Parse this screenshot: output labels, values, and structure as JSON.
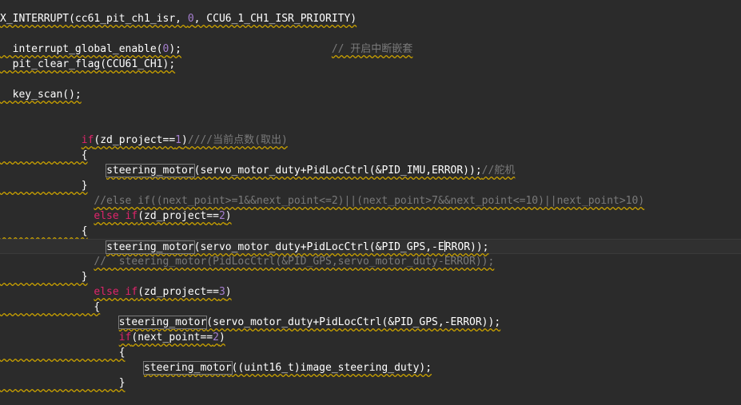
{
  "editor": {
    "lines": [
      [
        [
          "tx",
          "X_INTERRUPT(cc61_pit_ch1_isr, "
        ],
        [
          "num",
          "0"
        ],
        [
          "tx",
          ", CCU6_1_CH1_ISR_PRIORITY)"
        ]
      ],
      [],
      [
        [
          "tx",
          "  interrupt_global_enable("
        ],
        [
          "num",
          "0"
        ],
        [
          "tx",
          ");"
        ],
        [
          "tx",
          "                        "
        ],
        [
          "cm",
          "// 开启中断嵌套"
        ]
      ],
      [
        [
          "tx",
          "  pit_clear_flag(CCU61_CH1);"
        ]
      ],
      [],
      [
        [
          "tx",
          "  key_scan();"
        ]
      ],
      [],
      [],
      [
        [
          "tx",
          "             "
        ],
        [
          "kw",
          "if"
        ],
        [
          "tx",
          "(zd_project=="
        ],
        [
          "num",
          "1"
        ],
        [
          "tx",
          ")"
        ],
        [
          "cm",
          "////当前点数(取出)"
        ]
      ],
      [
        [
          "tx",
          "             {"
        ]
      ],
      [
        [
          "tx",
          "                 "
        ],
        [
          "box",
          "steering_motor"
        ],
        [
          "tx",
          "(servo_motor_duty+PidLocCtrl(&PID_IMU,ERROR));"
        ],
        [
          "cm",
          "//舵机"
        ]
      ],
      [
        [
          "tx",
          "             }"
        ]
      ],
      [
        [
          "tx",
          "               "
        ],
        [
          "cm",
          "//else if((next_point>=1&&next_point<=2)||(next_point>7&&next_point<=10)||next_point>10)"
        ]
      ],
      [
        [
          "tx",
          "               "
        ],
        [
          "kw",
          "else if"
        ],
        [
          "tx",
          "(zd_project=="
        ],
        [
          "num",
          "2"
        ],
        [
          "tx",
          ")"
        ]
      ],
      [
        [
          "tx",
          "             {"
        ]
      ],
      [
        [
          "tx",
          "                 "
        ],
        [
          "box",
          "steering_motor"
        ],
        [
          "tx",
          "(servo_motor_duty+PidLocCtrl(&PID_GPS,-E"
        ],
        [
          "cursor",
          ""
        ],
        [
          "tx",
          "RROR));"
        ]
      ],
      [
        [
          "tx",
          "               "
        ],
        [
          "cm",
          "//  steering_motor(PidLocCtrl(&PID_GPS,servo_motor_duty-ERROR));"
        ]
      ],
      [
        [
          "tx",
          "             }"
        ]
      ],
      [
        [
          "tx",
          "               "
        ],
        [
          "kw",
          "else if"
        ],
        [
          "tx",
          "(zd_project=="
        ],
        [
          "num",
          "3"
        ],
        [
          "tx",
          ")"
        ]
      ],
      [
        [
          "tx",
          "               {"
        ]
      ],
      [
        [
          "tx",
          "                   "
        ],
        [
          "box",
          "steering_motor"
        ],
        [
          "tx",
          "(servo_motor_duty+PidLocCtrl(&PID_GPS,-ERROR));"
        ]
      ],
      [
        [
          "tx",
          "                   "
        ],
        [
          "kw",
          "if"
        ],
        [
          "tx",
          "(next_point=="
        ],
        [
          "num",
          "2"
        ],
        [
          "tx",
          ")"
        ]
      ],
      [
        [
          "tx",
          "                   {"
        ]
      ],
      [
        [
          "tx",
          "                       "
        ],
        [
          "box",
          "steering_motor"
        ],
        [
          "tx",
          "((uint16_t)image_steering_duty);"
        ]
      ],
      [
        [
          "tx",
          "                   }"
        ]
      ]
    ],
    "current_line": 15,
    "squiggle_lines": [
      0,
      2,
      3,
      5,
      8,
      9,
      10,
      11,
      12,
      13,
      14,
      15,
      16,
      17,
      18,
      19,
      20,
      21,
      22,
      23,
      24
    ],
    "colors": {
      "background": "#2b2b2b",
      "text": "#ffffff",
      "keyword": "#e0246b",
      "number": "#a67fd0",
      "comment": "#7a7a7a",
      "squiggle": "#c8a000"
    }
  }
}
